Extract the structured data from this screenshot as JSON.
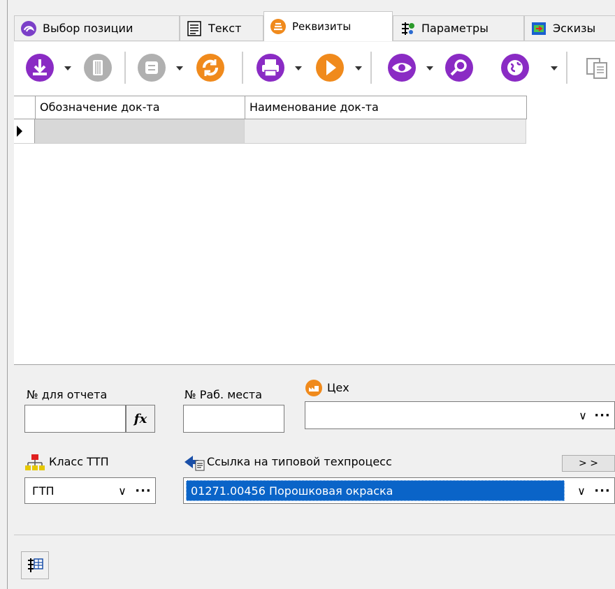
{
  "tabs": [
    {
      "label": "Выбор позиции",
      "icon": "swirl-icon",
      "active": false
    },
    {
      "label": "Текст",
      "icon": "text-doc-icon",
      "active": false
    },
    {
      "label": "Реквизиты",
      "icon": "stack-icon",
      "active": true
    },
    {
      "label": "Параметры",
      "icon": "parameters-icon",
      "active": false
    },
    {
      "label": "Эскизы",
      "icon": "sketch-icon",
      "active": false
    }
  ],
  "toolbar": {
    "buttons": [
      "download-icon",
      "column-icon",
      "stop-icon",
      "refresh-icon",
      "print-icon",
      "play-icon",
      "view-icon",
      "search-icon",
      "globe-icon",
      "copy-icon"
    ],
    "colors": {
      "purple": "#8a2bc4",
      "orange": "#f08a1c",
      "gray": "#b0b0b0"
    }
  },
  "grid": {
    "columns": [
      "Обозначение док-та",
      "Наименование док-та"
    ],
    "rows": [
      [
        "",
        ""
      ]
    ]
  },
  "form": {
    "report_no_label": "№ для отчета",
    "report_no_value": "",
    "formula_button": "fx",
    "workplace_label": "№ Раб. места",
    "workplace_value": "",
    "workshop_label": "Цех",
    "workshop_value": "",
    "ttp_class_label": "Класс ТТП",
    "ttp_class_value": "ГТП",
    "typical_process_label": "Ссылка на типовой техпроцесс",
    "typical_process_value": "01271.00456  Порошковая окраска",
    "goto_button": "> >",
    "ellipsis": "···",
    "chevron": "∨"
  }
}
